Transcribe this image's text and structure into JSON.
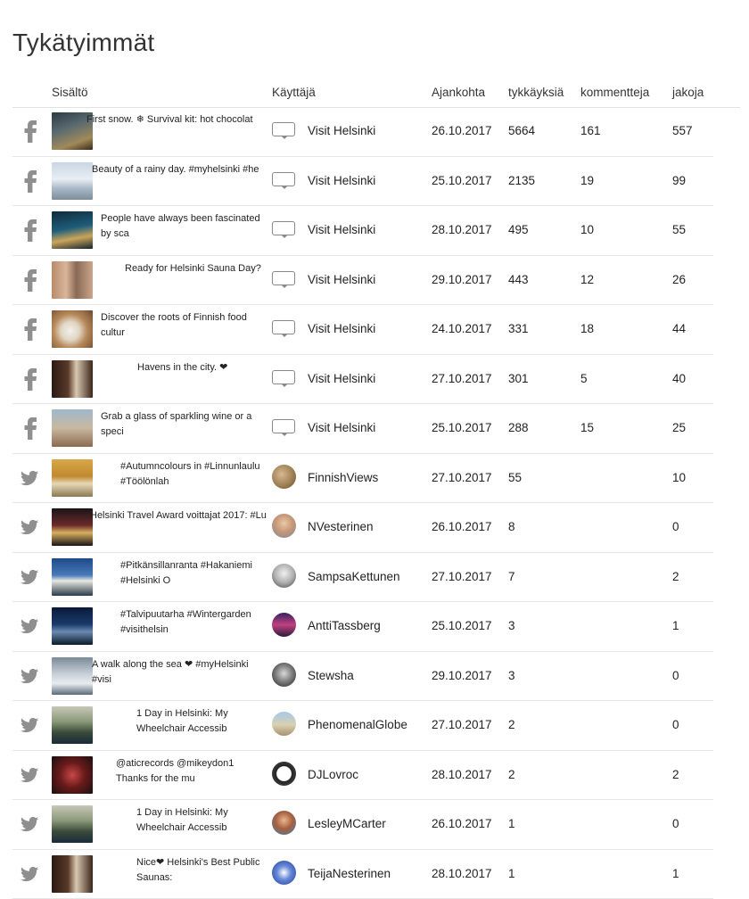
{
  "page": {
    "title": "Tykätyimmät"
  },
  "columns": {
    "content": "Sisältö",
    "user": "Käyttäjä",
    "date": "Ajankohta",
    "likes": "tykkäyksiä",
    "comments": "kommentteja",
    "shares": "jakoja"
  },
  "rows": [
    {
      "network": "facebook",
      "text": "First snow. ❄ Survival kit: hot chocolat",
      "text_left": 83,
      "user": "Visit Helsinki",
      "avatar": "visit-helsinki-logo",
      "date": "26.10.2017",
      "likes": "5664",
      "comments": "161",
      "shares": "557",
      "thumb": "linear-gradient(160deg,#2b3a44 0%,#5a6a70 40%,#a08a5a 75%,#3a2a1a 100%)"
    },
    {
      "network": "facebook",
      "text": "Beauty of a rainy day. #myhelsinki #he",
      "text_left": 89,
      "user": "Visit Helsinki",
      "avatar": "visit-helsinki-logo",
      "date": "25.10.2017",
      "likes": "2135",
      "comments": "19",
      "shares": "99",
      "thumb": "linear-gradient(180deg,#c9d6e2 0%,#e8eef4 45%,#a7b7c6 70%,#7f8d99 100%)"
    },
    {
      "network": "facebook",
      "text": "People have always been fascinated by sca",
      "text_left": 99,
      "user": "Visit Helsinki",
      "avatar": "visit-helsinki-logo",
      "date": "28.10.2017",
      "likes": "495",
      "comments": "10",
      "shares": "55",
      "thumb": "linear-gradient(170deg,#0f2b3d 0%,#1e5d7a 45%,#caa55a 70%,#13242e 100%)"
    },
    {
      "network": "facebook",
      "text": "Ready for Helsinki Sauna Day?",
      "text_left": 126,
      "user": "Visit Helsinki",
      "avatar": "visit-helsinki-logo",
      "date": "29.10.2017",
      "likes": "443",
      "comments": "12",
      "shares": "26",
      "thumb": "linear-gradient(90deg,#b88b6a 0%,#d9b59a 35%,#8a6a55 60%,#c9a58a 100%)"
    },
    {
      "network": "facebook",
      "text": "Discover the roots of Finnish food cultur",
      "text_left": 99,
      "user": "Visit Helsinki",
      "avatar": "visit-helsinki-logo",
      "date": "24.10.2017",
      "likes": "331",
      "comments": "18",
      "shares": "44",
      "thumb": "radial-gradient(circle at 45% 55%,#f2f0ea 0%,#e0d6c4 30%,#b8895a 55%,#6b4a2e 100%)"
    },
    {
      "network": "facebook",
      "text": "Havens in the city. ❤",
      "text_left": 140,
      "user": "Visit Helsinki",
      "avatar": "visit-helsinki-logo",
      "date": "27.10.2017",
      "likes": "301",
      "comments": "5",
      "shares": "40",
      "thumb": "linear-gradient(90deg,#2a1a14 0%,#5a3a2a 40%,#d8c8b0 60%,#3a2418 100%)"
    },
    {
      "network": "facebook",
      "text": "Grab a glass of sparkling wine or a speci",
      "text_left": 99,
      "user": "Visit Helsinki",
      "avatar": "visit-helsinki-logo",
      "date": "25.10.2017",
      "likes": "288",
      "comments": "15",
      "shares": "25",
      "thumb": "linear-gradient(180deg,#9fb8cc 0%,#c9b8a0 50%,#8a6a50 100%)"
    },
    {
      "network": "twitter",
      "text": "#Autumncolours in #Linnunlaulu #Töölönlah",
      "text_left": 121,
      "user": "FinnishViews",
      "avatar": "radial-gradient(circle at 40% 40%,#d8b890 0%,#9a7a50 60%,#5a4a30 100%)",
      "date": "27.10.2017",
      "likes": "55",
      "comments": "",
      "shares": "10",
      "thumb": "linear-gradient(180deg,#d8a848 0%,#c08a30 45%,#e8d8b8 65%,#8a7a50 100%)"
    },
    {
      "network": "twitter",
      "text": "Helsinki Travel Award voittajat 2017: #Lu",
      "text_left": 87,
      "user": "NVesterinen",
      "avatar": "radial-gradient(circle at 50% 40%,#e8c8a8 0%,#c89878 45%,#7a8890 100%)",
      "date": "26.10.2017",
      "likes": "8",
      "comments": "",
      "shares": "0",
      "thumb": "linear-gradient(180deg,#1a1418 0%,#6a2a2a 45%,#d8b060 65%,#1a1418 100%)"
    },
    {
      "network": "twitter",
      "text": "#Pitkänsillanranta #Hakaniemi #Helsinki O",
      "text_left": 121,
      "user": "SampsaKettunen",
      "avatar": "radial-gradient(circle at 50% 40%,#f0f0f0 0%,#b0b0b0 50%,#404040 100%)",
      "date": "27.10.2017",
      "likes": "7",
      "comments": "",
      "shares": "2",
      "thumb": "linear-gradient(180deg,#1e4a8a 0%,#4a7ab8 45%,#e8e8e0 60%,#2a3a4a 100%)"
    },
    {
      "network": "twitter",
      "text": "#Talvipuutarha #Wintergarden #visithelsin",
      "text_left": 121,
      "user": "AnttiTassberg",
      "avatar": "linear-gradient(180deg,#3a2060 0%,#c04080 50%,#2a1a3a 100%)",
      "date": "25.10.2017",
      "likes": "3",
      "comments": "",
      "shares": "1",
      "thumb": "linear-gradient(180deg,#0a1a3a 0%,#1a3a6a 45%,#6a8ab0 65%,#0a1a2a 100%)"
    },
    {
      "network": "twitter",
      "text": "A walk along the sea ❤ #myHelsinki #visi",
      "text_left": 89,
      "user": "Stewsha",
      "avatar": "radial-gradient(circle at 50% 45%,#d8d8d8 0%,#808080 45%,#202020 100%)",
      "date": "29.10.2017",
      "likes": "3",
      "comments": "",
      "shares": "0",
      "thumb": "linear-gradient(180deg,#7a8a98 0%,#c8d0d8 45%,#e8ecf0 70%,#5a6a78 100%)"
    },
    {
      "network": "twitter",
      "text": "1 Day in Helsinki: My Wheelchair Accessib",
      "text_left": 139,
      "user": "PhenomenalGlobe",
      "avatar": "linear-gradient(180deg,#a8c8e8 0%,#d8d0b0 55%,#a89070 100%)",
      "date": "27.10.2017",
      "likes": "2",
      "comments": "",
      "shares": "0",
      "thumb": "linear-gradient(180deg,#c8c8b8 0%,#8a9a7a 40%,#3a4a3a 70%,#1a2a3a 100%)"
    },
    {
      "network": "twitter",
      "text": "@aticrecords @mikeydon1 Thanks for the mu",
      "text_left": 116,
      "user": "DJLovroc",
      "avatar": "lovroc-logo",
      "date": "28.10.2017",
      "likes": "2",
      "comments": "",
      "shares": "2",
      "thumb": "radial-gradient(circle at 50% 50%,#c84848 0%,#6a1a1a 45%,#1a1010 100%)"
    },
    {
      "network": "twitter",
      "text": "1 Day in Helsinki: My Wheelchair Accessib",
      "text_left": 139,
      "user": "LesleyMCarter",
      "avatar": "radial-gradient(circle at 50% 40%,#e8b890 0%,#a86040 45%,#3a80a8 100%)",
      "date": "26.10.2017",
      "likes": "1",
      "comments": "",
      "shares": "0",
      "thumb": "linear-gradient(180deg,#c8c8b8 0%,#8a9a7a 40%,#3a4a3a 70%,#1a2a3a 100%)"
    },
    {
      "network": "twitter",
      "text": "Nice❤ Helsinki's Best Public Saunas:",
      "text_left": 139,
      "user": "TeijaNesterinen",
      "avatar": "radial-gradient(circle at 50% 50%,#ffffff 0%,#6a8ad8 40%,#1a3a9a 100%)",
      "date": "28.10.2017",
      "likes": "1",
      "comments": "",
      "shares": "1",
      "thumb": "linear-gradient(90deg,#2a1a14 0%,#5a3a2a 40%,#d8c8b0 60%,#3a2418 100%)"
    }
  ]
}
